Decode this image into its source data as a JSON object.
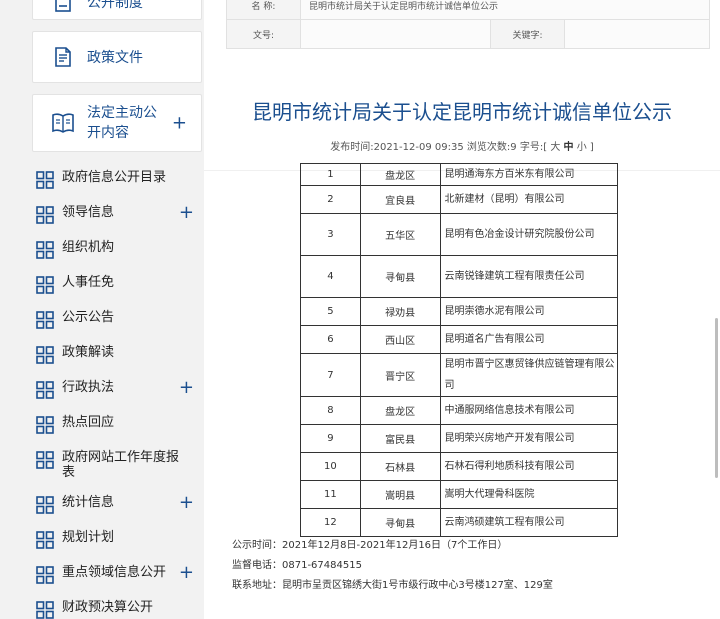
{
  "sidebar": {
    "buttons": [
      {
        "label": "公开制度",
        "icon": "document-icon"
      },
      {
        "label": "政策文件",
        "icon": "document-edit-icon"
      },
      {
        "label": "法定主动公开内容",
        "icon": "book-icon",
        "plus": "+"
      }
    ],
    "items": [
      {
        "label": "政府信息公开目录",
        "plus": ""
      },
      {
        "label": "领导信息",
        "plus": "+"
      },
      {
        "label": "组织机构",
        "plus": ""
      },
      {
        "label": "人事任免",
        "plus": ""
      },
      {
        "label": "公示公告",
        "plus": ""
      },
      {
        "label": "政策解读",
        "plus": ""
      },
      {
        "label": "行政执法",
        "plus": "+"
      },
      {
        "label": "热点回应",
        "plus": ""
      },
      {
        "label": "政府网站工作年度报表",
        "plus": ""
      },
      {
        "label": "统计信息",
        "plus": "+"
      },
      {
        "label": "规划计划",
        "plus": ""
      },
      {
        "label": "重点领域信息公开",
        "plus": "+"
      },
      {
        "label": "财政预决算公开",
        "plus": ""
      }
    ]
  },
  "meta": {
    "name_label": "名 称:",
    "name_value": "昆明市统计局关于认定昆明市统计诚信单位公示",
    "doc_label": "文号:",
    "doc_value": "",
    "keyword_label": "关键字:",
    "keyword_value": ""
  },
  "article": {
    "title": "昆明市统计局关于认定昆明市统计诚信单位公示",
    "publish_prefix": "发布时间:",
    "publish_time": "2021-12-09 09:35",
    "views_prefix": "浏览次数:",
    "views": "9",
    "fontsize_prefix": "字号:[",
    "font_large": "大",
    "font_medium": "中",
    "font_small": "小",
    "fontsize_suffix": "]"
  },
  "table": {
    "rows": [
      {
        "no": "1",
        "county": "盘龙区",
        "company": "昆明通海东方百米东有限公司"
      },
      {
        "no": "2",
        "county": "宜良县",
        "company": "北新建材（昆明）有限公司"
      },
      {
        "no": "3",
        "county": "五华区",
        "company": "昆明有色冶金设计研究院股份公司"
      },
      {
        "no": "4",
        "county": "寻甸县",
        "company": "云南锐锋建筑工程有限责任公司"
      },
      {
        "no": "5",
        "county": "禄劝县",
        "company": "昆明崇德水泥有限公司"
      },
      {
        "no": "6",
        "county": "西山区",
        "company": "昆明道名广告有限公司"
      },
      {
        "no": "7",
        "county": "晋宁区",
        "company": "昆明市晋宁区惠贸锋供应链管理有限公司"
      },
      {
        "no": "8",
        "county": "盘龙区",
        "company": "中通服网络信息技术有限公司"
      },
      {
        "no": "9",
        "county": "富民县",
        "company": "昆明荣兴房地产开发有限公司"
      },
      {
        "no": "10",
        "county": "石林县",
        "company": "石林石得利地质科技有限公司"
      },
      {
        "no": "11",
        "county": "嵩明县",
        "company": "嵩明大代理骨科医院"
      },
      {
        "no": "12",
        "county": "寻甸县",
        "company": "云南鸿硕建筑工程有限公司"
      }
    ]
  },
  "footer": {
    "period": "公示时间：2021年12月8日-2021年12月16日（7个工作日）",
    "phone": "监督电话：0871-67484515",
    "address": "联系地址：昆明市呈贡区锦绣大街1号市级行政中心3号楼127室、129室"
  },
  "colors": {
    "brand": "#1b4f8f"
  }
}
